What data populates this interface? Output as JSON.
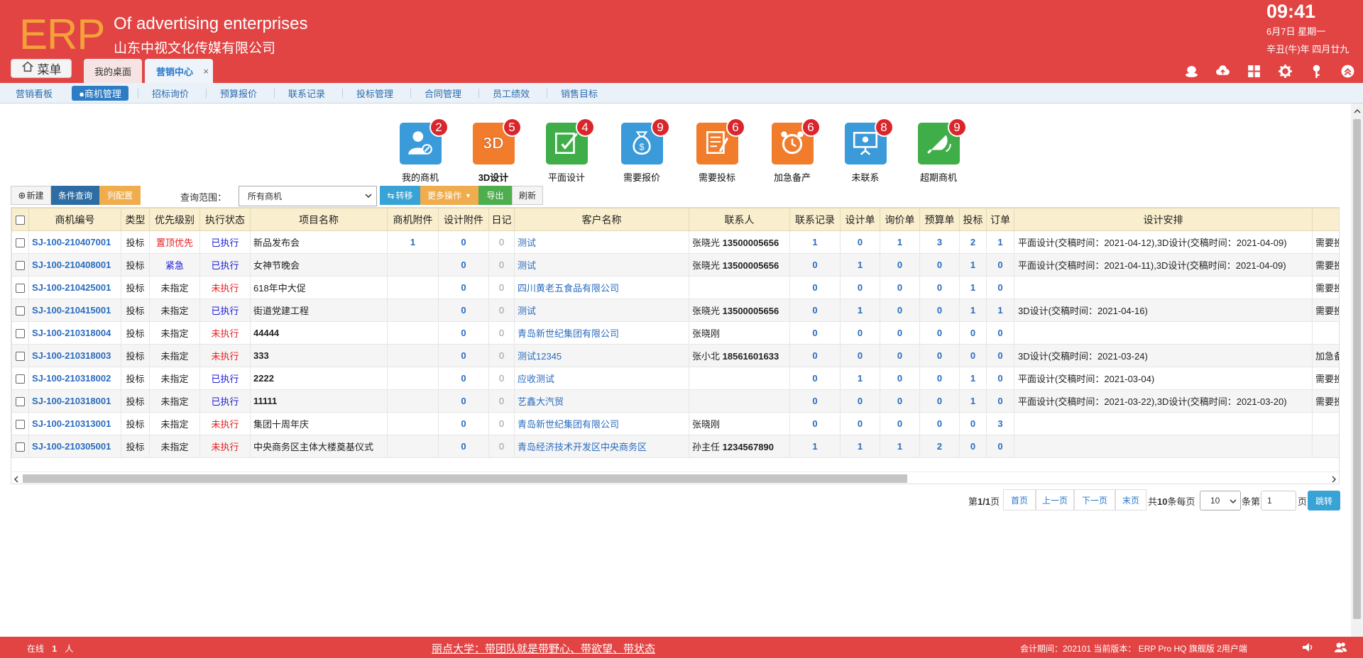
{
  "header": {
    "logo": "ERP",
    "company_en": "Of advertising enterprises",
    "company_cn": "山东中视文化传媒有限公司",
    "time": "09:41",
    "date": "6月7日 星期一",
    "lunar": "辛丑(牛)年 四月廿九",
    "menu_label": "菜单",
    "tabs": [
      {
        "label": "我的桌面"
      },
      {
        "label": "营销中心",
        "close": "×"
      }
    ]
  },
  "subnav": {
    "items": [
      {
        "label": "营销看板"
      },
      {
        "label": "●商机管理"
      },
      {
        "label": "招标询价"
      },
      {
        "label": "预算报价"
      },
      {
        "label": "联系记录"
      },
      {
        "label": "投标管理"
      },
      {
        "label": "合同管理"
      },
      {
        "label": "员工绩效"
      },
      {
        "label": "销售目标"
      }
    ]
  },
  "quick": [
    {
      "label": "我的商机",
      "badge": "2",
      "color": "#3b9ad9",
      "icon": "user-icon"
    },
    {
      "label": "3D设计",
      "badge": "5",
      "color": "#f07c2c",
      "icon": "3d-icon"
    },
    {
      "label": "平面设计",
      "badge": "4",
      "color": "#3fae49",
      "icon": "edit-icon"
    },
    {
      "label": "需要报价",
      "badge": "9",
      "color": "#3b9ad9",
      "icon": "money-bag-icon"
    },
    {
      "label": "需要投标",
      "badge": "6",
      "color": "#f07c2c",
      "icon": "document-icon"
    },
    {
      "label": "加急备产",
      "badge": "6",
      "color": "#f07c2c",
      "icon": "alarm-icon"
    },
    {
      "label": "未联系",
      "badge": "8",
      "color": "#3b9ad9",
      "icon": "presentation-icon"
    },
    {
      "label": "超期商机",
      "badge": "9",
      "color": "#3fae49",
      "icon": "bell-icon"
    }
  ],
  "toolbar": {
    "new": "新建",
    "query": "条件查询",
    "columns": "列配置",
    "scope_label": "查询范围：",
    "scope_value": "所有商机",
    "move": "转移",
    "more": "更多操作",
    "export": "导出",
    "refresh": "刷新"
  },
  "table": {
    "headers": [
      "商机编号",
      "类型",
      "优先级别",
      "执行状态",
      "项目名称",
      "商机附件",
      "设计附件",
      "日记",
      "客户名称",
      "联系人",
      "联系记录",
      "设计单",
      "询价单",
      "预算单",
      "投标",
      "订单",
      "设计安排",
      ""
    ],
    "rows": [
      {
        "code": "SJ-100-210407001",
        "type": "投标",
        "priority": "置顶优先",
        "prio_cls": "prio-red",
        "status": "已执行",
        "st_cls": "st-done",
        "project": "新品发布会",
        "proj_bold": false,
        "att": "1",
        "datt": "0",
        "diary": "0",
        "customer": "测试",
        "contact": "张晓光",
        "phone": "13500005656",
        "rec": "1",
        "design": "0",
        "inquiry": "1",
        "budget": "3",
        "bid": "2",
        "order": "1",
        "plan": "平面设计(交稿时间：2021-04-12),3D设计(交稿时间：2021-04-09)",
        "extra": "需要投标("
      },
      {
        "code": "SJ-100-210408001",
        "type": "投标",
        "priority": "紧急",
        "prio_cls": "prio-blue",
        "status": "已执行",
        "st_cls": "st-done",
        "project": "女神节晚会",
        "proj_bold": false,
        "att": "",
        "datt": "0",
        "diary": "0",
        "customer": "测试",
        "contact": "张晓光",
        "phone": "13500005656",
        "rec": "0",
        "design": "1",
        "inquiry": "0",
        "budget": "0",
        "bid": "1",
        "order": "0",
        "plan": "平面设计(交稿时间：2021-04-11),3D设计(交稿时间：2021-04-09)",
        "extra": "需要投标("
      },
      {
        "code": "SJ-100-210425001",
        "type": "投标",
        "priority": "未指定",
        "prio_cls": "",
        "status": "未执行",
        "st_cls": "st-todo",
        "project": "618年中大促",
        "proj_bold": false,
        "att": "",
        "datt": "0",
        "diary": "0",
        "customer": "四川黄老五食品有限公司",
        "contact": "",
        "phone": "",
        "rec": "0",
        "design": "0",
        "inquiry": "0",
        "budget": "0",
        "bid": "1",
        "order": "0",
        "plan": "",
        "extra": "需要投标("
      },
      {
        "code": "SJ-100-210415001",
        "type": "投标",
        "priority": "未指定",
        "prio_cls": "",
        "status": "已执行",
        "st_cls": "st-done",
        "project": "街道党建工程",
        "proj_bold": false,
        "att": "",
        "datt": "0",
        "diary": "0",
        "customer": "测试",
        "contact": "张晓光",
        "phone": "13500005656",
        "rec": "0",
        "design": "1",
        "inquiry": "0",
        "budget": "0",
        "bid": "1",
        "order": "1",
        "plan": "3D设计(交稿时间：2021-04-16)",
        "extra": "需要投标("
      },
      {
        "code": "SJ-100-210318004",
        "type": "投标",
        "priority": "未指定",
        "prio_cls": "",
        "status": "未执行",
        "st_cls": "st-todo",
        "project": "44444",
        "proj_bold": true,
        "att": "",
        "datt": "0",
        "diary": "0",
        "customer": "青岛新世纪集团有限公司",
        "contact": "张晓刚",
        "phone": "",
        "rec": "0",
        "design": "0",
        "inquiry": "0",
        "budget": "0",
        "bid": "0",
        "order": "0",
        "plan": "",
        "extra": ""
      },
      {
        "code": "SJ-100-210318003",
        "type": "投标",
        "priority": "未指定",
        "prio_cls": "",
        "status": "未执行",
        "st_cls": "st-todo",
        "project": "333",
        "proj_bold": true,
        "att": "",
        "datt": "0",
        "diary": "0",
        "customer": "测试12345",
        "contact": "张小北",
        "phone": "18561601633",
        "rec": "0",
        "design": "0",
        "inquiry": "0",
        "budget": "0",
        "bid": "0",
        "order": "0",
        "plan": "3D设计(交稿时间：2021-03-24)",
        "extra": "加急备产"
      },
      {
        "code": "SJ-100-210318002",
        "type": "投标",
        "priority": "未指定",
        "prio_cls": "",
        "status": "已执行",
        "st_cls": "st-done",
        "project": "2222",
        "proj_bold": true,
        "att": "",
        "datt": "0",
        "diary": "0",
        "customer": "应收测试",
        "contact": "",
        "phone": "",
        "rec": "0",
        "design": "1",
        "inquiry": "0",
        "budget": "0",
        "bid": "1",
        "order": "0",
        "plan": "平面设计(交稿时间：2021-03-04)",
        "extra": "需要投标"
      },
      {
        "code": "SJ-100-210318001",
        "type": "投标",
        "priority": "未指定",
        "prio_cls": "",
        "status": "已执行",
        "st_cls": "st-done",
        "project": "11111",
        "proj_bold": true,
        "att": "",
        "datt": "0",
        "diary": "0",
        "customer": "艺鑫大汽贸",
        "contact": "",
        "phone": "",
        "rec": "0",
        "design": "0",
        "inquiry": "0",
        "budget": "0",
        "bid": "1",
        "order": "0",
        "plan": "平面设计(交稿时间：2021-03-22),3D设计(交稿时间：2021-03-20)",
        "extra": "需要投标("
      },
      {
        "code": "SJ-100-210313001",
        "type": "投标",
        "priority": "未指定",
        "prio_cls": "",
        "status": "未执行",
        "st_cls": "st-todo",
        "project": "集团十周年庆",
        "proj_bold": false,
        "att": "",
        "datt": "0",
        "diary": "0",
        "customer": "青岛新世纪集团有限公司",
        "contact": "张晓刚",
        "phone": "",
        "rec": "0",
        "design": "0",
        "inquiry": "0",
        "budget": "0",
        "bid": "0",
        "order": "3",
        "plan": "",
        "extra": ""
      },
      {
        "code": "SJ-100-210305001",
        "type": "投标",
        "priority": "未指定",
        "prio_cls": "",
        "status": "未执行",
        "st_cls": "st-todo",
        "project": "中央商务区主体大楼奠基仪式",
        "proj_bold": false,
        "att": "",
        "datt": "0",
        "diary": "0",
        "customer": "青岛经济技术开发区中央商务区",
        "contact": "孙主任",
        "phone": "1234567890",
        "rec": "1",
        "design": "1",
        "inquiry": "1",
        "budget": "2",
        "bid": "0",
        "order": "0",
        "plan": "",
        "extra": ""
      }
    ]
  },
  "pager": {
    "page_info_prefix": "第",
    "page_info_value": "1/1",
    "page_info_suffix": "页",
    "first": "首页",
    "prev": "上一页",
    "next": "下一页",
    "last": "末页",
    "total_prefix": "共",
    "total_value": "10",
    "total_suffix": "条每页",
    "per_page": "10",
    "goto_prefix": "条第",
    "goto_value": "1",
    "goto_suffix": "页",
    "jump": "跳转"
  },
  "footer": {
    "online_prefix": "在线",
    "online_count": "1",
    "online_suffix": "人",
    "slogan": "丽点大学：带团队就是带野心、带欲望、带状态",
    "info": "会计期间：202101 当前版本： ERP Pro HQ 旗舰版 2用户端"
  },
  "colors": {
    "brand_red": "#e24444",
    "logo_orange": "#f3a23a",
    "link_blue": "#2a6cbf",
    "header_row": "#f9eecd"
  }
}
